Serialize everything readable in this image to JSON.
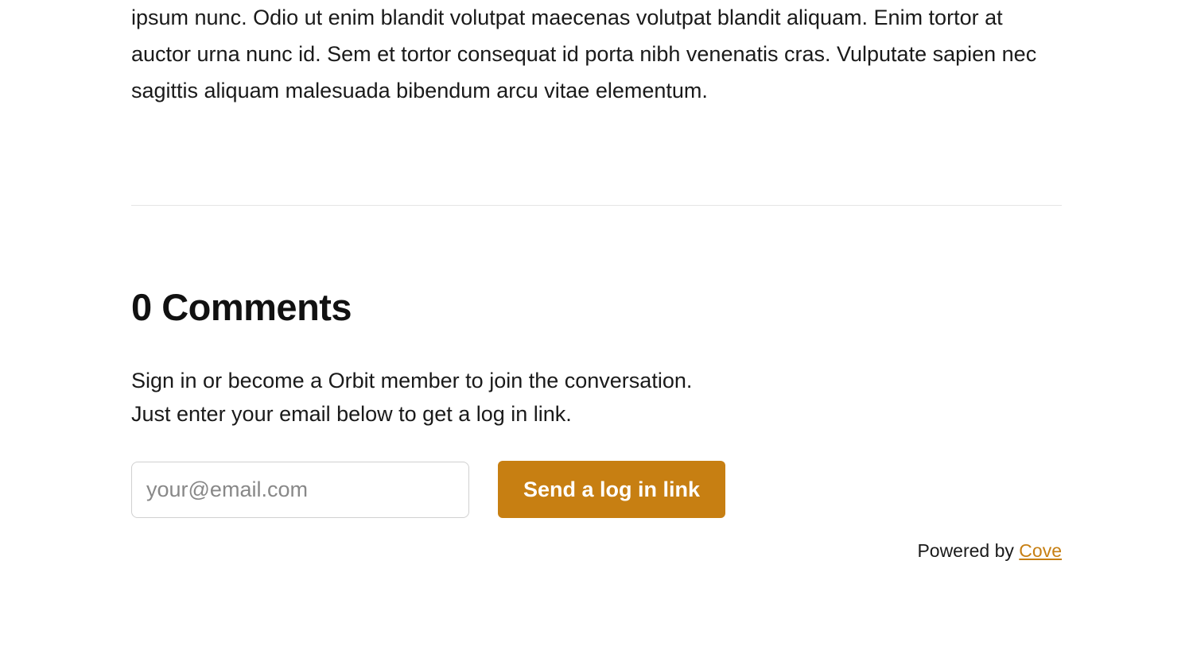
{
  "article": {
    "body_fragment": "ipsum nunc. Odio ut enim blandit volutpat maecenas volutpat blandit aliquam. Enim tortor at auctor urna nunc id. Sem et tortor consequat id porta nibh venenatis cras. Vulputate sapien nec sagittis aliquam malesuada bibendum arcu vitae elementum."
  },
  "comments": {
    "heading": "0 Comments",
    "signin_line1": "Sign in or become a Orbit member to join the conversation.",
    "signin_line2": "Just enter your email below to get a log in link.",
    "email_placeholder": "your@email.com",
    "submit_label": "Send a log in link"
  },
  "attribution": {
    "prefix": "Powered by ",
    "link_text": "Cove"
  },
  "colors": {
    "accent": "#c77f12"
  }
}
